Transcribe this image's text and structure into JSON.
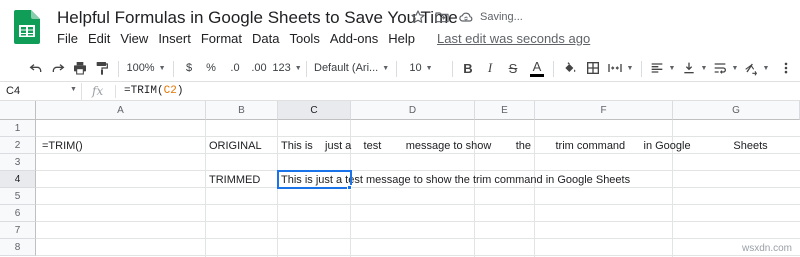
{
  "app": {
    "doc_title": "Helpful Formulas in Google Sheets to Save You Time",
    "saving_status": "Saving...",
    "last_edit": "Last edit was seconds ago",
    "brand_color": "#0F9D58"
  },
  "menu": [
    "File",
    "Edit",
    "View",
    "Insert",
    "Format",
    "Data",
    "Tools",
    "Add-ons",
    "Help"
  ],
  "toolbar": {
    "zoom": "100%",
    "currency": "$",
    "percent": "%",
    "decrease_decimal": ".0",
    "increase_decimal": ".00",
    "more_formats": "123",
    "font_family": "Default (Ari...",
    "font_size": "10",
    "bold": "B",
    "italic": "I",
    "strikethrough": "S",
    "text_color_letter": "A"
  },
  "formula_bar": {
    "name_box": "C4",
    "fx_label": "fx",
    "formula_prefix": "=TRIM(",
    "formula_ref": "C2",
    "formula_suffix": ")"
  },
  "grid": {
    "columns": [
      "A",
      "B",
      "C",
      "D",
      "E",
      "F",
      "G"
    ],
    "rows": [
      "1",
      "2",
      "3",
      "4",
      "5",
      "6",
      "7",
      "8"
    ],
    "selected_cell": "C4",
    "cells": {
      "A2": "=TRIM()",
      "B2": "ORIGINAL",
      "C2": "This is    just a    test        message to show        the        trim command      in Google              Sheets",
      "B4": "TRIMMED",
      "C4": "This is just a test message to show the trim command in Google Sheets"
    }
  },
  "watermark": "wsxdn.com"
}
